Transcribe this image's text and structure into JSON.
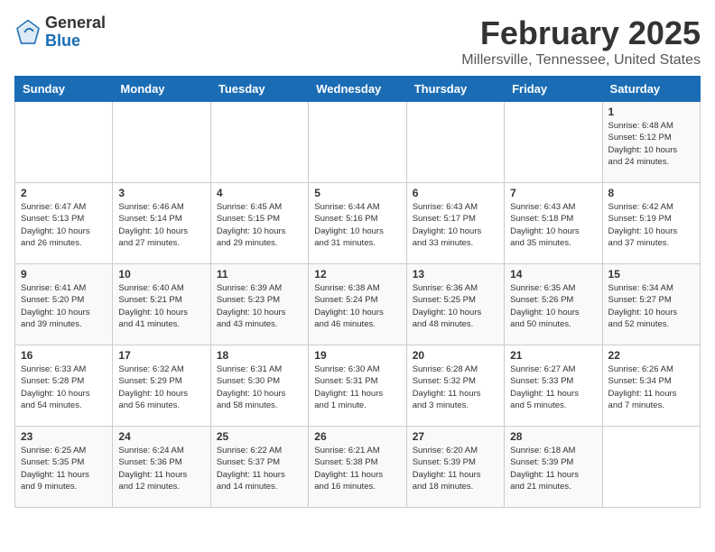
{
  "logo": {
    "general": "General",
    "blue": "Blue"
  },
  "title": "February 2025",
  "subtitle": "Millersville, Tennessee, United States",
  "headers": [
    "Sunday",
    "Monday",
    "Tuesday",
    "Wednesday",
    "Thursday",
    "Friday",
    "Saturday"
  ],
  "weeks": [
    [
      {
        "day": "",
        "info": ""
      },
      {
        "day": "",
        "info": ""
      },
      {
        "day": "",
        "info": ""
      },
      {
        "day": "",
        "info": ""
      },
      {
        "day": "",
        "info": ""
      },
      {
        "day": "",
        "info": ""
      },
      {
        "day": "1",
        "info": "Sunrise: 6:48 AM\nSunset: 5:12 PM\nDaylight: 10 hours\nand 24 minutes."
      }
    ],
    [
      {
        "day": "2",
        "info": "Sunrise: 6:47 AM\nSunset: 5:13 PM\nDaylight: 10 hours\nand 26 minutes."
      },
      {
        "day": "3",
        "info": "Sunrise: 6:46 AM\nSunset: 5:14 PM\nDaylight: 10 hours\nand 27 minutes."
      },
      {
        "day": "4",
        "info": "Sunrise: 6:45 AM\nSunset: 5:15 PM\nDaylight: 10 hours\nand 29 minutes."
      },
      {
        "day": "5",
        "info": "Sunrise: 6:44 AM\nSunset: 5:16 PM\nDaylight: 10 hours\nand 31 minutes."
      },
      {
        "day": "6",
        "info": "Sunrise: 6:43 AM\nSunset: 5:17 PM\nDaylight: 10 hours\nand 33 minutes."
      },
      {
        "day": "7",
        "info": "Sunrise: 6:43 AM\nSunset: 5:18 PM\nDaylight: 10 hours\nand 35 minutes."
      },
      {
        "day": "8",
        "info": "Sunrise: 6:42 AM\nSunset: 5:19 PM\nDaylight: 10 hours\nand 37 minutes."
      }
    ],
    [
      {
        "day": "9",
        "info": "Sunrise: 6:41 AM\nSunset: 5:20 PM\nDaylight: 10 hours\nand 39 minutes."
      },
      {
        "day": "10",
        "info": "Sunrise: 6:40 AM\nSunset: 5:21 PM\nDaylight: 10 hours\nand 41 minutes."
      },
      {
        "day": "11",
        "info": "Sunrise: 6:39 AM\nSunset: 5:23 PM\nDaylight: 10 hours\nand 43 minutes."
      },
      {
        "day": "12",
        "info": "Sunrise: 6:38 AM\nSunset: 5:24 PM\nDaylight: 10 hours\nand 46 minutes."
      },
      {
        "day": "13",
        "info": "Sunrise: 6:36 AM\nSunset: 5:25 PM\nDaylight: 10 hours\nand 48 minutes."
      },
      {
        "day": "14",
        "info": "Sunrise: 6:35 AM\nSunset: 5:26 PM\nDaylight: 10 hours\nand 50 minutes."
      },
      {
        "day": "15",
        "info": "Sunrise: 6:34 AM\nSunset: 5:27 PM\nDaylight: 10 hours\nand 52 minutes."
      }
    ],
    [
      {
        "day": "16",
        "info": "Sunrise: 6:33 AM\nSunset: 5:28 PM\nDaylight: 10 hours\nand 54 minutes."
      },
      {
        "day": "17",
        "info": "Sunrise: 6:32 AM\nSunset: 5:29 PM\nDaylight: 10 hours\nand 56 minutes."
      },
      {
        "day": "18",
        "info": "Sunrise: 6:31 AM\nSunset: 5:30 PM\nDaylight: 10 hours\nand 58 minutes."
      },
      {
        "day": "19",
        "info": "Sunrise: 6:30 AM\nSunset: 5:31 PM\nDaylight: 11 hours\nand 1 minute."
      },
      {
        "day": "20",
        "info": "Sunrise: 6:28 AM\nSunset: 5:32 PM\nDaylight: 11 hours\nand 3 minutes."
      },
      {
        "day": "21",
        "info": "Sunrise: 6:27 AM\nSunset: 5:33 PM\nDaylight: 11 hours\nand 5 minutes."
      },
      {
        "day": "22",
        "info": "Sunrise: 6:26 AM\nSunset: 5:34 PM\nDaylight: 11 hours\nand 7 minutes."
      }
    ],
    [
      {
        "day": "23",
        "info": "Sunrise: 6:25 AM\nSunset: 5:35 PM\nDaylight: 11 hours\nand 9 minutes."
      },
      {
        "day": "24",
        "info": "Sunrise: 6:24 AM\nSunset: 5:36 PM\nDaylight: 11 hours\nand 12 minutes."
      },
      {
        "day": "25",
        "info": "Sunrise: 6:22 AM\nSunset: 5:37 PM\nDaylight: 11 hours\nand 14 minutes."
      },
      {
        "day": "26",
        "info": "Sunrise: 6:21 AM\nSunset: 5:38 PM\nDaylight: 11 hours\nand 16 minutes."
      },
      {
        "day": "27",
        "info": "Sunrise: 6:20 AM\nSunset: 5:39 PM\nDaylight: 11 hours\nand 18 minutes."
      },
      {
        "day": "28",
        "info": "Sunrise: 6:18 AM\nSunset: 5:39 PM\nDaylight: 11 hours\nand 21 minutes."
      },
      {
        "day": "",
        "info": ""
      }
    ]
  ]
}
